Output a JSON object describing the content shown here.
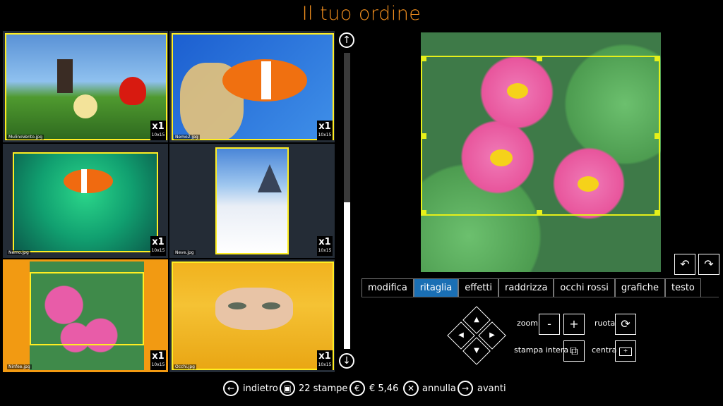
{
  "header": {
    "title": "Il tuo ordine"
  },
  "thumbnails": [
    {
      "filename": "MulinoVento.jpg",
      "qty": "x1",
      "format": "10x15"
    },
    {
      "filename": "Nemo2.jpg",
      "qty": "x1",
      "format": "10x15"
    },
    {
      "filename": "Nemo.jpg",
      "qty": "x1",
      "format": "10x15"
    },
    {
      "filename": "Neve.jpg",
      "qty": "x1",
      "format": "10x15"
    },
    {
      "filename": "Ninfee.jpg",
      "qty": "x1",
      "format": "10x15"
    },
    {
      "filename": "Occhi.jpg",
      "qty": "x1",
      "format": "10x15"
    }
  ],
  "editor": {
    "tabs": [
      "modifica",
      "ritaglia",
      "effetti",
      "raddrizza",
      "occhi rossi",
      "grafiche",
      "testo"
    ],
    "active_tab": "ritaglia",
    "zoom_label": "zoom",
    "zoom_minus": "-",
    "zoom_plus": "+",
    "rotate_label": "ruota",
    "full_print_label": "stampa intera",
    "center_label": "centra"
  },
  "bottom": {
    "back": "indietro",
    "prints": "22 stampe",
    "price": "€ 5,46",
    "cancel": "annulla",
    "next": "avanti"
  },
  "colors": {
    "accent": "#f4901e",
    "selected_thumb": "#f29a12",
    "crop": "#e6f01a",
    "active_tab": "#1a6fb4"
  }
}
